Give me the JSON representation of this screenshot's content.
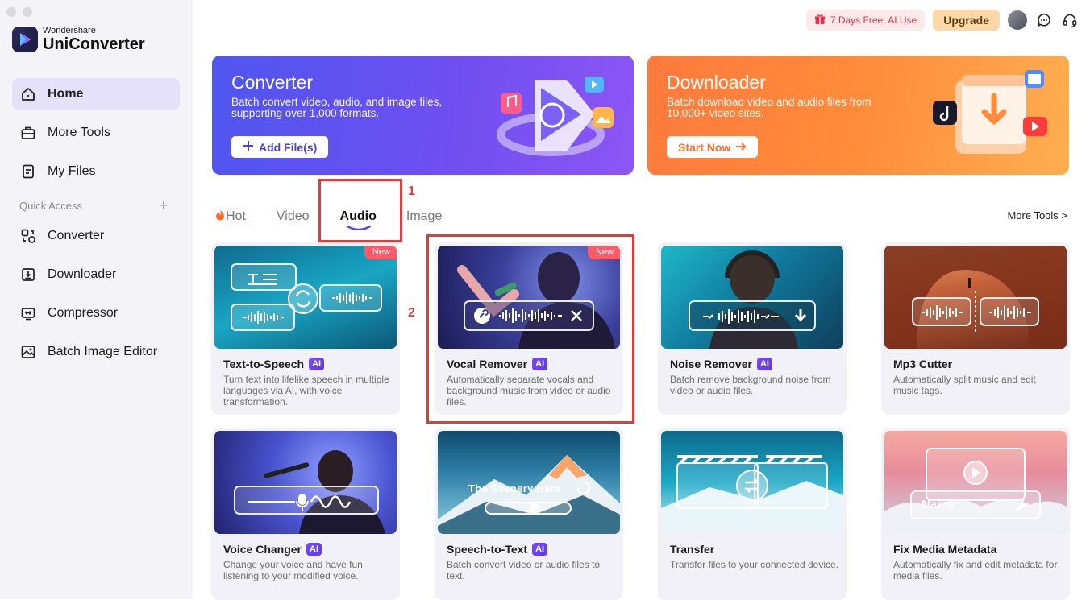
{
  "app": {
    "brand_small": "Wondershare",
    "brand_big": "UniConverter"
  },
  "sidebar": {
    "nav": [
      {
        "label": "Home",
        "icon": "home-icon",
        "active": true
      },
      {
        "label": "More Tools",
        "icon": "toolbox-icon"
      },
      {
        "label": "My Files",
        "icon": "file-icon"
      }
    ],
    "quick_access_label": "Quick Access",
    "quick_access_add": "+",
    "quick": [
      {
        "label": "Converter",
        "icon": "converter-icon"
      },
      {
        "label": "Downloader",
        "icon": "downloader-icon"
      },
      {
        "label": "Compressor",
        "icon": "compressor-icon"
      },
      {
        "label": "Batch Image Editor",
        "icon": "image-editor-icon"
      }
    ]
  },
  "topbar": {
    "promo": "7 Days Free: AI Use",
    "upgrade": "Upgrade"
  },
  "banners": {
    "converter": {
      "title": "Converter",
      "desc": "Batch convert video, audio, and image files, supporting over 1,000 formats.",
      "button": "Add File(s)"
    },
    "downloader": {
      "title": "Downloader",
      "desc": "Batch download video and audio files from 10,000+ video sites.",
      "button": "Start Now"
    }
  },
  "tabs": {
    "items": [
      "Hot",
      "Video",
      "Audio",
      "Image"
    ],
    "active": "Audio",
    "more_tools": "More Tools >"
  },
  "annotations": {
    "n1": "1",
    "n2": "2"
  },
  "badges": {
    "new": "New",
    "ai": "AI"
  },
  "cards": [
    {
      "title": "Text-to-Speech",
      "ai": true,
      "new": true,
      "desc": "Turn text into lifelike speech in multiple languages via AI, with voice transformation."
    },
    {
      "title": "Vocal Remover",
      "ai": true,
      "new": true,
      "desc": "Automatically separate vocals and background music from video or audio files."
    },
    {
      "title": "Noise Remover",
      "ai": true,
      "new": false,
      "desc": "Batch remove background noise from video or audio files."
    },
    {
      "title": "Mp3 Cutter",
      "ai": false,
      "new": false,
      "desc": "Automatically split music and edit music tags."
    },
    {
      "title": "Voice Changer",
      "ai": true,
      "new": false,
      "desc": "Change your voice and have fun listening to your modified voice."
    },
    {
      "title": "Speech-to-Text",
      "ai": true,
      "new": false,
      "desc": "Batch convert video or audio files to text.",
      "thumb_text": "The Scenery Here"
    },
    {
      "title": "Transfer",
      "ai": false,
      "new": false,
      "desc": "Transfer files to your connected device."
    },
    {
      "title": "Fix Media Metadata",
      "ai": false,
      "new": false,
      "desc": "Automatically fix and edit metadata for media files.",
      "thumb_text": "Name"
    }
  ],
  "colors": {
    "accent": "#5b45e8",
    "annotation_red": "#e33a3a",
    "sidebar_bg": "#f4f3f8"
  }
}
